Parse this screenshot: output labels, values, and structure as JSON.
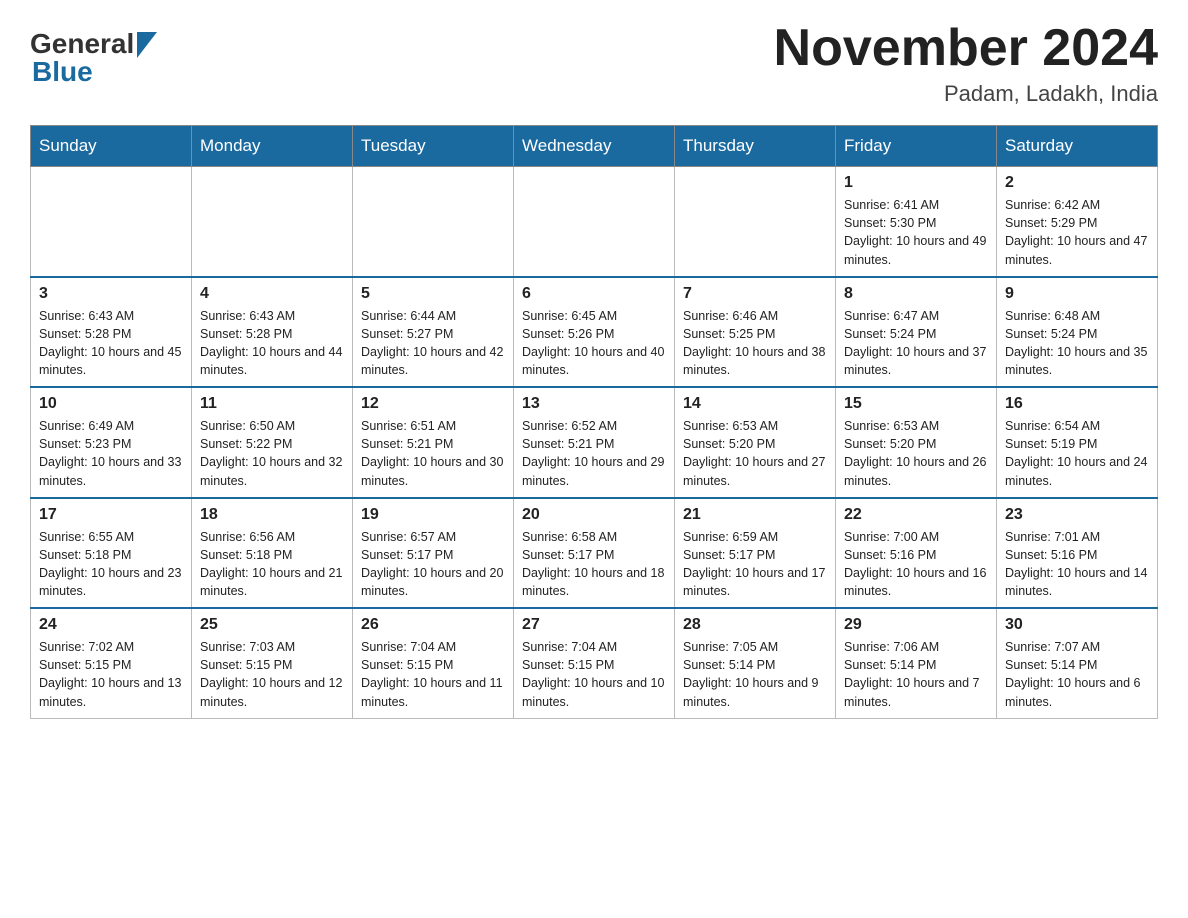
{
  "header": {
    "logo_general": "General",
    "logo_blue": "Blue",
    "title": "November 2024",
    "location": "Padam, Ladakh, India"
  },
  "weekdays": [
    "Sunday",
    "Monday",
    "Tuesday",
    "Wednesday",
    "Thursday",
    "Friday",
    "Saturday"
  ],
  "weeks": [
    [
      {
        "day": "",
        "sunrise": "",
        "sunset": "",
        "daylight": ""
      },
      {
        "day": "",
        "sunrise": "",
        "sunset": "",
        "daylight": ""
      },
      {
        "day": "",
        "sunrise": "",
        "sunset": "",
        "daylight": ""
      },
      {
        "day": "",
        "sunrise": "",
        "sunset": "",
        "daylight": ""
      },
      {
        "day": "",
        "sunrise": "",
        "sunset": "",
        "daylight": ""
      },
      {
        "day": "1",
        "sunrise": "Sunrise: 6:41 AM",
        "sunset": "Sunset: 5:30 PM",
        "daylight": "Daylight: 10 hours and 49 minutes."
      },
      {
        "day": "2",
        "sunrise": "Sunrise: 6:42 AM",
        "sunset": "Sunset: 5:29 PM",
        "daylight": "Daylight: 10 hours and 47 minutes."
      }
    ],
    [
      {
        "day": "3",
        "sunrise": "Sunrise: 6:43 AM",
        "sunset": "Sunset: 5:28 PM",
        "daylight": "Daylight: 10 hours and 45 minutes."
      },
      {
        "day": "4",
        "sunrise": "Sunrise: 6:43 AM",
        "sunset": "Sunset: 5:28 PM",
        "daylight": "Daylight: 10 hours and 44 minutes."
      },
      {
        "day": "5",
        "sunrise": "Sunrise: 6:44 AM",
        "sunset": "Sunset: 5:27 PM",
        "daylight": "Daylight: 10 hours and 42 minutes."
      },
      {
        "day": "6",
        "sunrise": "Sunrise: 6:45 AM",
        "sunset": "Sunset: 5:26 PM",
        "daylight": "Daylight: 10 hours and 40 minutes."
      },
      {
        "day": "7",
        "sunrise": "Sunrise: 6:46 AM",
        "sunset": "Sunset: 5:25 PM",
        "daylight": "Daylight: 10 hours and 38 minutes."
      },
      {
        "day": "8",
        "sunrise": "Sunrise: 6:47 AM",
        "sunset": "Sunset: 5:24 PM",
        "daylight": "Daylight: 10 hours and 37 minutes."
      },
      {
        "day": "9",
        "sunrise": "Sunrise: 6:48 AM",
        "sunset": "Sunset: 5:24 PM",
        "daylight": "Daylight: 10 hours and 35 minutes."
      }
    ],
    [
      {
        "day": "10",
        "sunrise": "Sunrise: 6:49 AM",
        "sunset": "Sunset: 5:23 PM",
        "daylight": "Daylight: 10 hours and 33 minutes."
      },
      {
        "day": "11",
        "sunrise": "Sunrise: 6:50 AM",
        "sunset": "Sunset: 5:22 PM",
        "daylight": "Daylight: 10 hours and 32 minutes."
      },
      {
        "day": "12",
        "sunrise": "Sunrise: 6:51 AM",
        "sunset": "Sunset: 5:21 PM",
        "daylight": "Daylight: 10 hours and 30 minutes."
      },
      {
        "day": "13",
        "sunrise": "Sunrise: 6:52 AM",
        "sunset": "Sunset: 5:21 PM",
        "daylight": "Daylight: 10 hours and 29 minutes."
      },
      {
        "day": "14",
        "sunrise": "Sunrise: 6:53 AM",
        "sunset": "Sunset: 5:20 PM",
        "daylight": "Daylight: 10 hours and 27 minutes."
      },
      {
        "day": "15",
        "sunrise": "Sunrise: 6:53 AM",
        "sunset": "Sunset: 5:20 PM",
        "daylight": "Daylight: 10 hours and 26 minutes."
      },
      {
        "day": "16",
        "sunrise": "Sunrise: 6:54 AM",
        "sunset": "Sunset: 5:19 PM",
        "daylight": "Daylight: 10 hours and 24 minutes."
      }
    ],
    [
      {
        "day": "17",
        "sunrise": "Sunrise: 6:55 AM",
        "sunset": "Sunset: 5:18 PM",
        "daylight": "Daylight: 10 hours and 23 minutes."
      },
      {
        "day": "18",
        "sunrise": "Sunrise: 6:56 AM",
        "sunset": "Sunset: 5:18 PM",
        "daylight": "Daylight: 10 hours and 21 minutes."
      },
      {
        "day": "19",
        "sunrise": "Sunrise: 6:57 AM",
        "sunset": "Sunset: 5:17 PM",
        "daylight": "Daylight: 10 hours and 20 minutes."
      },
      {
        "day": "20",
        "sunrise": "Sunrise: 6:58 AM",
        "sunset": "Sunset: 5:17 PM",
        "daylight": "Daylight: 10 hours and 18 minutes."
      },
      {
        "day": "21",
        "sunrise": "Sunrise: 6:59 AM",
        "sunset": "Sunset: 5:17 PM",
        "daylight": "Daylight: 10 hours and 17 minutes."
      },
      {
        "day": "22",
        "sunrise": "Sunrise: 7:00 AM",
        "sunset": "Sunset: 5:16 PM",
        "daylight": "Daylight: 10 hours and 16 minutes."
      },
      {
        "day": "23",
        "sunrise": "Sunrise: 7:01 AM",
        "sunset": "Sunset: 5:16 PM",
        "daylight": "Daylight: 10 hours and 14 minutes."
      }
    ],
    [
      {
        "day": "24",
        "sunrise": "Sunrise: 7:02 AM",
        "sunset": "Sunset: 5:15 PM",
        "daylight": "Daylight: 10 hours and 13 minutes."
      },
      {
        "day": "25",
        "sunrise": "Sunrise: 7:03 AM",
        "sunset": "Sunset: 5:15 PM",
        "daylight": "Daylight: 10 hours and 12 minutes."
      },
      {
        "day": "26",
        "sunrise": "Sunrise: 7:04 AM",
        "sunset": "Sunset: 5:15 PM",
        "daylight": "Daylight: 10 hours and 11 minutes."
      },
      {
        "day": "27",
        "sunrise": "Sunrise: 7:04 AM",
        "sunset": "Sunset: 5:15 PM",
        "daylight": "Daylight: 10 hours and 10 minutes."
      },
      {
        "day": "28",
        "sunrise": "Sunrise: 7:05 AM",
        "sunset": "Sunset: 5:14 PM",
        "daylight": "Daylight: 10 hours and 9 minutes."
      },
      {
        "day": "29",
        "sunrise": "Sunrise: 7:06 AM",
        "sunset": "Sunset: 5:14 PM",
        "daylight": "Daylight: 10 hours and 7 minutes."
      },
      {
        "day": "30",
        "sunrise": "Sunrise: 7:07 AM",
        "sunset": "Sunset: 5:14 PM",
        "daylight": "Daylight: 10 hours and 6 minutes."
      }
    ]
  ]
}
